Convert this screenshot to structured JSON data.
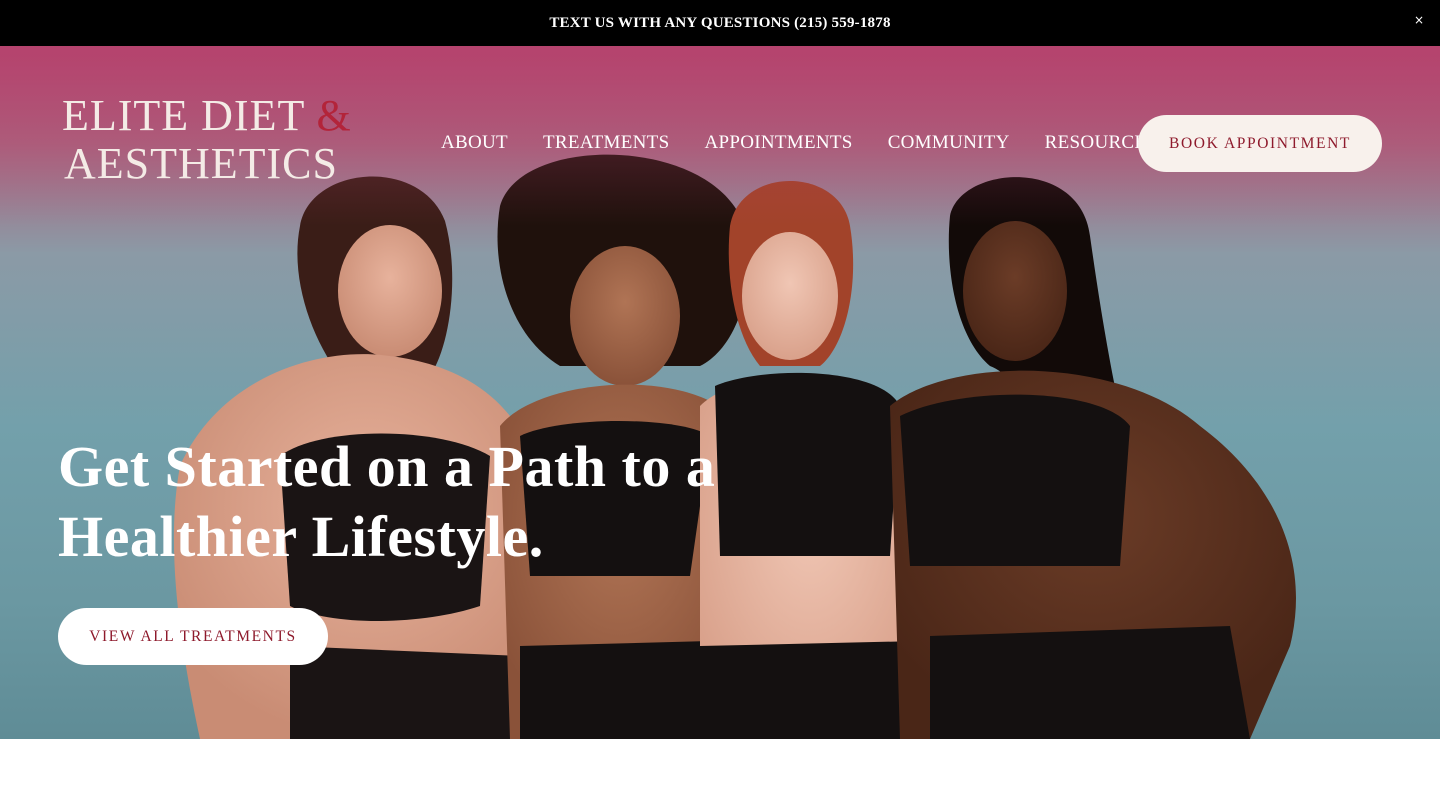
{
  "announcement": {
    "text": "TEXT US WITH ANY QUESTIONS (215) 559-1878",
    "close_icon": "×"
  },
  "brand": {
    "logo_line1": "ELITE DIET",
    "logo_amp": "&",
    "logo_line2": "AESTHETICS",
    "accent_color": "#8e1a2c"
  },
  "nav": {
    "items": [
      "ABOUT",
      "TREATMENTS",
      "APPOINTMENTS",
      "COMMUNITY",
      "RESOURCES"
    ],
    "book_label": "BOOK APPOINTMENT"
  },
  "hero": {
    "headline_line1": "Get Started on a Path to a",
    "headline_line2": "Healthier Lifestyle.",
    "cta_label": "VIEW ALL TREATMENTS"
  }
}
